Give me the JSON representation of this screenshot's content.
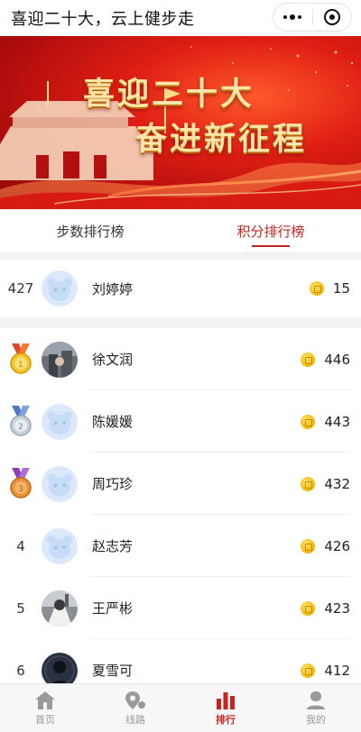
{
  "app": {
    "title": "喜迎二十大，云上健步走"
  },
  "capsule": {
    "more_icon": "more-dots-icon",
    "close_icon": "target-close-icon"
  },
  "banner": {
    "line1": "喜迎二十大",
    "line2": "奋进新征程"
  },
  "tabs": [
    {
      "label": "步数排行榜",
      "active": false
    },
    {
      "label": "积分排行榜",
      "active": true
    }
  ],
  "me": {
    "rank": "427",
    "name": "刘婷婷",
    "score": "15"
  },
  "leaderboard": [
    {
      "rank": "1",
      "name": "徐文润",
      "score": "446",
      "medal": "gold"
    },
    {
      "rank": "2",
      "name": "陈媛媛",
      "score": "443",
      "medal": "silver"
    },
    {
      "rank": "3",
      "name": "周巧珍",
      "score": "432",
      "medal": "bronze"
    },
    {
      "rank": "4",
      "name": "赵志芳",
      "score": "426"
    },
    {
      "rank": "5",
      "name": "王严彬",
      "score": "423"
    },
    {
      "rank": "6",
      "name": "夏雪可",
      "score": "412"
    }
  ],
  "bottom_nav": [
    {
      "label": "首页",
      "icon": "home-icon",
      "active": false
    },
    {
      "label": "线路",
      "icon": "route-icon",
      "active": false
    },
    {
      "label": "排行",
      "icon": "ranking-bars-icon",
      "active": true
    },
    {
      "label": "我的",
      "icon": "user-icon",
      "active": false
    }
  ],
  "colors": {
    "accent": "#c8231e",
    "coin": "#f2b600",
    "banner": "#e01f14"
  }
}
